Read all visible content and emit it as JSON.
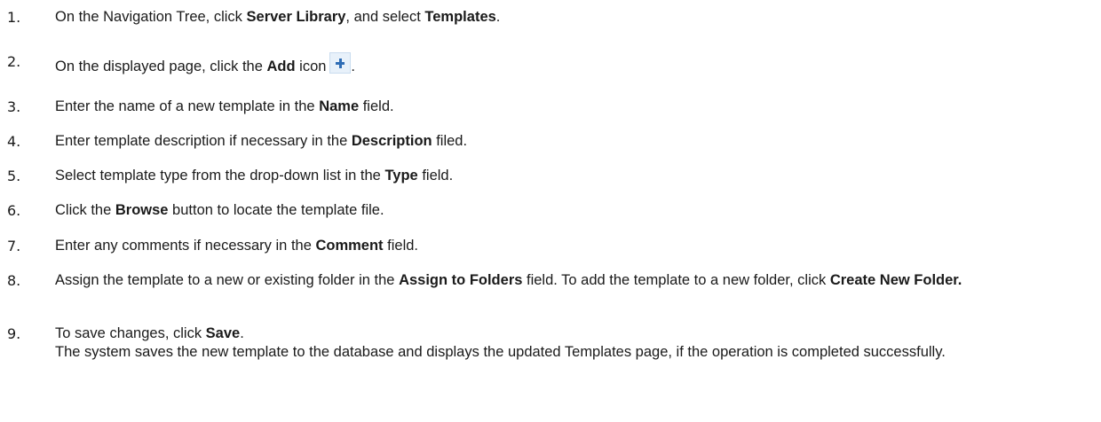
{
  "steps": [
    {
      "num": "1.",
      "p1": "On the Navigation Tree, click ",
      "b1": "Server Library",
      "p2": ", and select ",
      "b2": "Templates",
      "p3": "."
    },
    {
      "num": "2.",
      "p1": "On the displayed page, click the ",
      "b1": "Add",
      "p2": " icon",
      "icon": "add-plus-icon",
      "p3": "."
    },
    {
      "num": "3.",
      "p1": "Enter the name of a new template in the ",
      "b1": "Name",
      "p2": " field."
    },
    {
      "num": "4.",
      "p1": "Enter template description if necessary in the ",
      "b1": "Description",
      "p2": " filed."
    },
    {
      "num": "5.",
      "p1": "Select template type from the drop-down list in the ",
      "b1": "Type",
      "p2": " field."
    },
    {
      "num": "6.",
      "p1": "Click the ",
      "b1": "Browse",
      "p2": " button to locate the template file."
    },
    {
      "num": "7.",
      "p1": "Enter any comments if necessary in the ",
      "b1": "Comment",
      "p2": " field."
    },
    {
      "num": "8.",
      "p1": "Assign the template to a new or existing folder in the ",
      "b1": "Assign to Folders",
      "p2": " field. To add the template to a new folder, click ",
      "b2": "Create New Folder."
    },
    {
      "num": "9.",
      "p1": "To save changes, click ",
      "b1": "Save",
      "p2": ".",
      "p3": "The system saves the new template to the database and displays the updated Templates page, if the operation is completed successfully."
    }
  ]
}
